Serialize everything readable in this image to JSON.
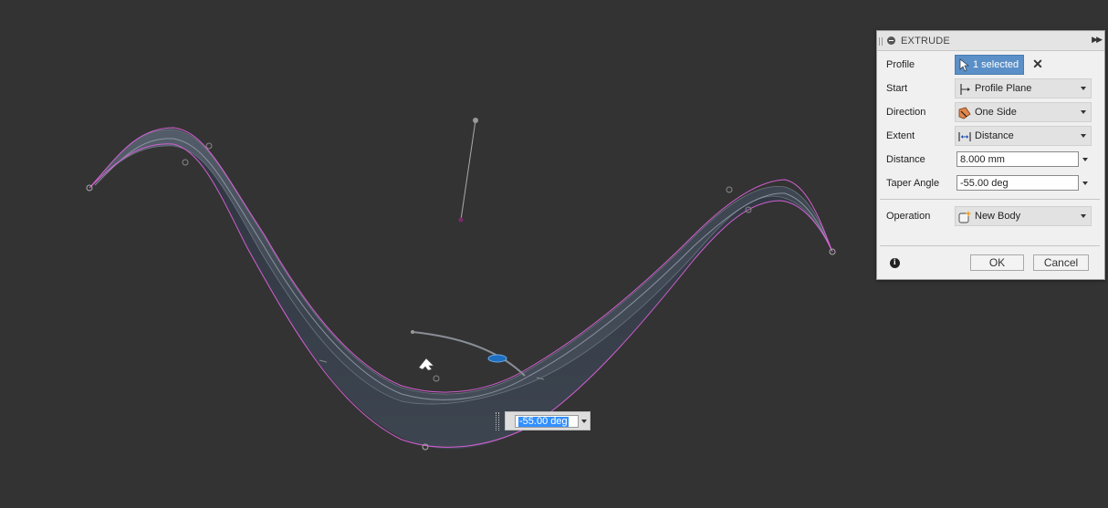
{
  "panel": {
    "title": "EXTRUDE",
    "rows": {
      "profile": {
        "label": "Profile",
        "button": "1 selected",
        "clear_icon": "close-icon"
      },
      "start": {
        "label": "Start",
        "value": "Profile Plane",
        "icon": "profile-plane-icon"
      },
      "direction": {
        "label": "Direction",
        "value": "One Side",
        "icon": "one-side-icon"
      },
      "extent": {
        "label": "Extent",
        "value": "Distance",
        "icon": "distance-icon"
      },
      "distance": {
        "label": "Distance",
        "value": "8.000 mm"
      },
      "taper": {
        "label": "Taper Angle",
        "value": "-55.00 deg"
      },
      "operation": {
        "label": "Operation",
        "value": "New Body",
        "icon": "new-body-icon"
      }
    },
    "ok_label": "OK",
    "cancel_label": "Cancel"
  },
  "viewport": {
    "float_input_value": "-55.00 deg"
  },
  "colors": {
    "background": "#333333",
    "profile_outline": "#d35fd3",
    "accent": "#5b8fc7",
    "selection": "#3390ff"
  }
}
